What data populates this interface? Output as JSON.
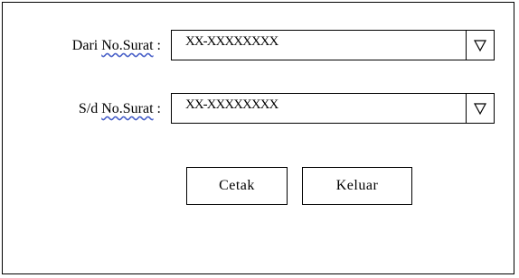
{
  "form": {
    "from_label_prefix": "Dari ",
    "from_label_link": "No.Surat",
    "from_label_suffix": " :",
    "from_value": "XX-XXXXXXXX",
    "to_label_prefix": "S/d ",
    "to_label_link": "No.Surat",
    "to_label_suffix": " :",
    "to_value": "XX-XXXXXXXX"
  },
  "icons": {
    "dropdown": "triangle-down-outline-icon"
  },
  "buttons": {
    "print_label": "Cetak",
    "exit_label": "Keluar"
  }
}
